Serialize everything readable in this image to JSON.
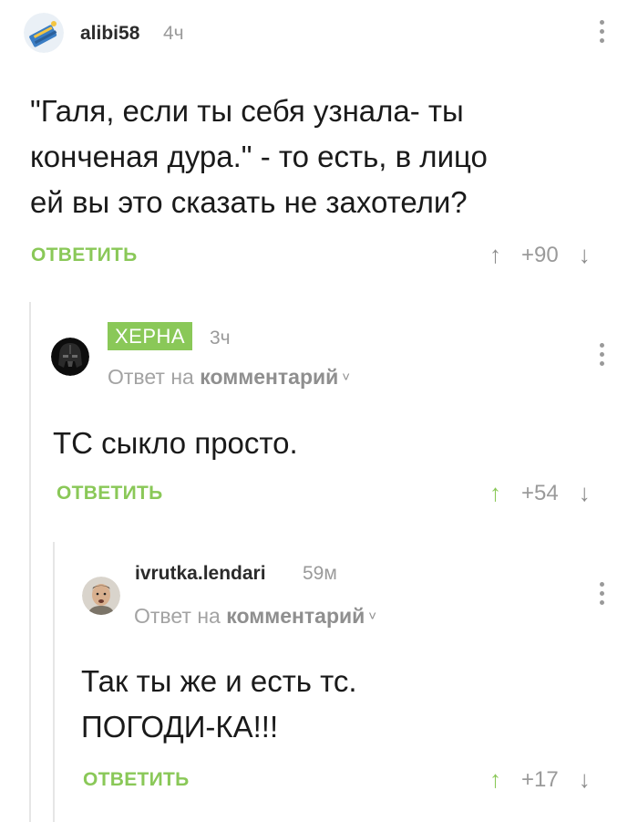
{
  "comments": [
    {
      "username": "alibi58",
      "time": "4ч",
      "text_lines": [
        "\"Галя, если ты себя узнала- ты",
        "конченая дура.\" - то есть, в лицо",
        "ей вы это сказать не захотели?"
      ],
      "reply_label": "ОТВЕТИТЬ",
      "score": "+90",
      "upvoted": false
    },
    {
      "username": "ХЕРНА",
      "time": "3ч",
      "reply_prefix": "Ответ на",
      "reply_target": "комментарий",
      "text_lines": [
        "ТС сыкло просто."
      ],
      "reply_label": "ОТВЕТИТЬ",
      "score": "+54",
      "upvoted": true
    },
    {
      "username": "ivrutka.lendari",
      "time": "59м",
      "reply_prefix": "Ответ на",
      "reply_target": "комментарий",
      "text_lines": [
        "Так ты же и есть тс.",
        "ПОГОДИ-КА!!!"
      ],
      "reply_label": "ОТВЕТИТЬ",
      "score": "+17",
      "upvoted": true
    }
  ],
  "icons": {
    "upvote": "arrow-up-icon",
    "downvote": "arrow-down-icon",
    "more": "more-vertical-icon",
    "chevron": "chevron-down-icon"
  },
  "colors": {
    "accent": "#8ac858",
    "muted": "#9a9a9a",
    "text": "#1a1a1a"
  }
}
